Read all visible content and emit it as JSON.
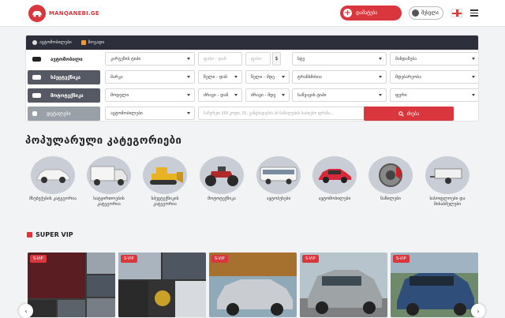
{
  "header": {
    "logo_text": "MANQANEBI.GE",
    "add_button": "დამატება",
    "login_button": "შესვლა"
  },
  "search": {
    "tabs": [
      "ავტომობილები",
      "ზოგადი"
    ],
    "categories": [
      "ავტომობილი",
      "სპეცტექნიკა",
      "მოტოტექნიკა",
      "დეტალები"
    ],
    "fields": {
      "body_type": "კარგეზის ტიპი",
      "price_from": "ფასი - დან",
      "price_to": "ფასი",
      "currency": "$",
      "deal": "სტე",
      "location": "მანდაზება",
      "make": "მარკა",
      "year_from": "წელი - დან",
      "year_to": "წელი - მდე",
      "transmission": "ტრანსმისია",
      "fuel": "მდებარეობა",
      "model": "მოდელი",
      "mileage_from": "ძრავი - დან",
      "mileage_to": "ძრავი - მდე",
      "fuel_type": "საწვავის ტიპი",
      "color": "ფერი",
      "subcategory": "ავტომობილები",
      "vin_placeholder": "ჩაწერეთ VIN კოდი, ID, განცხადების ან ნაწილების საძიებო ფრაზა...",
      "search_button": "ძიება"
    }
  },
  "popular": {
    "title": "პოპულარული კატეგორიები",
    "items": [
      {
        "label": "მსუბუქების კატეგორია"
      },
      {
        "label": "სატვირთოების კატეგორია"
      },
      {
        "label": "სპეცტექნიკის კატეგორია"
      },
      {
        "label": "მოტოტექნიკა"
      },
      {
        "label": "ავტობუსები"
      },
      {
        "label": "ავტომობილები"
      },
      {
        "label": "ნაწილები"
      },
      {
        "label": "სასოფლოები და მისაბმელები"
      }
    ]
  },
  "super_vip": {
    "title": "SUPER VIP",
    "badge": "S-VIP"
  },
  "colors": {
    "brand": "#d9363e",
    "dark_bar": "#2c2f3a"
  }
}
